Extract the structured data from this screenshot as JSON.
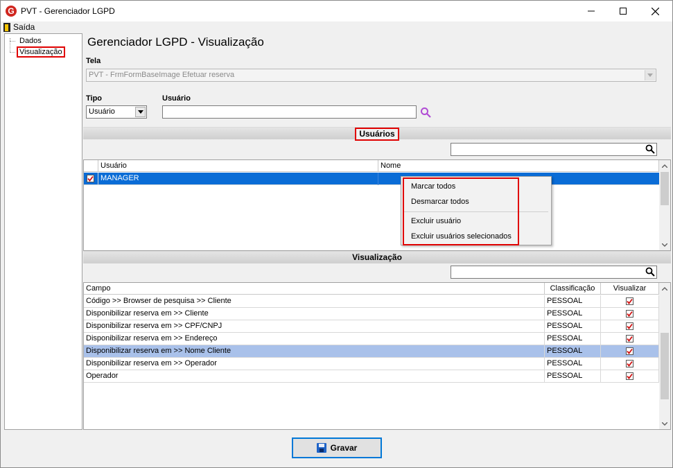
{
  "window": {
    "title": "PVT - Gerenciador LGPD",
    "app_icon_letter": "G"
  },
  "menu": {
    "exit_label": "Saída"
  },
  "tree": {
    "items": [
      {
        "label": "Dados"
      },
      {
        "label": "Visualização"
      }
    ]
  },
  "page": {
    "title": "Gerenciador LGPD - Visualização"
  },
  "tela": {
    "label": "Tela",
    "value": "PVT - FrmFormBaseImage Efetuar reserva"
  },
  "tipo": {
    "label": "Tipo",
    "value": "Usuário"
  },
  "usuario": {
    "label": "Usuário",
    "value": ""
  },
  "usuarios_section": {
    "title": "Usuários",
    "filter_value": "",
    "columns": [
      "Usuário",
      "Nome"
    ],
    "rows": [
      {
        "checked": true,
        "usuario": "MANAGER",
        "nome": ""
      }
    ]
  },
  "context_menu": {
    "items": [
      "Marcar todos",
      "Desmarcar todos",
      "Excluir usuário",
      "Excluir usuários selecionados"
    ]
  },
  "visualizacao_section": {
    "title": "Visualização",
    "filter_value": "",
    "columns": [
      "Campo",
      "Classificação",
      "Visualizar"
    ],
    "rows": [
      {
        "campo": "Código >> Browser de pesquisa >> Cliente",
        "classificacao": "PESSOAL",
        "visualizar": true
      },
      {
        "campo": "Disponibilizar reserva em >> Cliente",
        "classificacao": "PESSOAL",
        "visualizar": true
      },
      {
        "campo": "Disponibilizar reserva em >> CPF/CNPJ",
        "classificacao": "PESSOAL",
        "visualizar": true
      },
      {
        "campo": "Disponibilizar reserva em >> Endereço",
        "classificacao": "PESSOAL",
        "visualizar": true
      },
      {
        "campo": "Disponibilizar reserva em >> Nome Cliente",
        "classificacao": "PESSOAL",
        "visualizar": true
      },
      {
        "campo": "Disponibilizar reserva em >> Operador",
        "classificacao": "PESSOAL",
        "visualizar": true
      },
      {
        "campo": "Operador",
        "classificacao": "PESSOAL",
        "visualizar": true
      }
    ]
  },
  "actions": {
    "save_label": "Gravar"
  },
  "colors": {
    "highlight_red": "#e00000",
    "selection_blue": "#0a6cd6",
    "selection_light": "#a9c1ea",
    "check_red": "#d01010"
  }
}
